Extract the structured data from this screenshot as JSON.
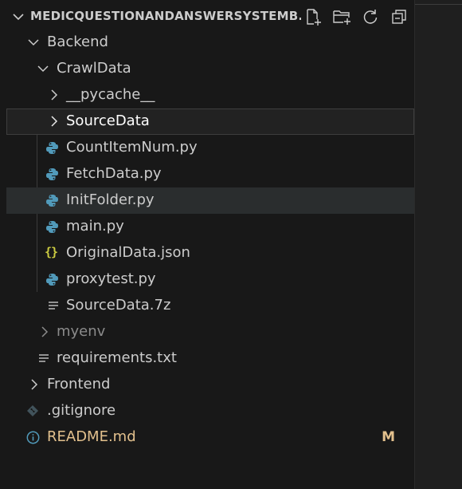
{
  "explorer": {
    "title": "MEDICQUESTIONANDANSWERSYSTEMB...",
    "actions": [
      {
        "name": "new-file",
        "icon": "new-file-icon"
      },
      {
        "name": "new-folder",
        "icon": "new-folder-icon"
      },
      {
        "name": "refresh",
        "icon": "refresh-icon"
      },
      {
        "name": "collapse-all",
        "icon": "collapse-all-icon"
      }
    ]
  },
  "tree": [
    {
      "label": "Backend",
      "type": "folder",
      "expanded": true
    },
    {
      "label": "CrawlData",
      "type": "folder",
      "expanded": true
    },
    {
      "label": "__pycache__",
      "type": "folder",
      "expanded": false
    },
    {
      "label": "SourceData",
      "type": "folder",
      "expanded": false
    },
    {
      "label": "CountItemNum.py",
      "type": "python",
      "icon": "python-icon"
    },
    {
      "label": "FetchData.py",
      "type": "python",
      "icon": "python-icon"
    },
    {
      "label": "InitFolder.py",
      "type": "python",
      "icon": "python-icon"
    },
    {
      "label": "main.py",
      "type": "python",
      "icon": "python-icon"
    },
    {
      "label": "OriginalData.json",
      "type": "json",
      "icon": "json-icon",
      "glyph": "{}"
    },
    {
      "label": "proxytest.py",
      "type": "python",
      "icon": "python-icon"
    },
    {
      "label": "SourceData.7z",
      "type": "archive",
      "icon": "text-file-icon"
    },
    {
      "label": "myenv",
      "type": "folder",
      "expanded": false
    },
    {
      "label": "requirements.txt",
      "type": "text",
      "icon": "text-file-icon"
    },
    {
      "label": "Frontend",
      "type": "folder",
      "expanded": false
    },
    {
      "label": ".gitignore",
      "type": "git",
      "icon": "git-icon"
    },
    {
      "label": "README.md",
      "type": "markdown",
      "icon": "info-icon",
      "badge": "M"
    }
  ],
  "colors": {
    "background": "#181818",
    "text": "#cccccc",
    "modified": "#e2c08d",
    "python": "#519aba",
    "json": "#cbcb41",
    "info": "#519aba"
  }
}
